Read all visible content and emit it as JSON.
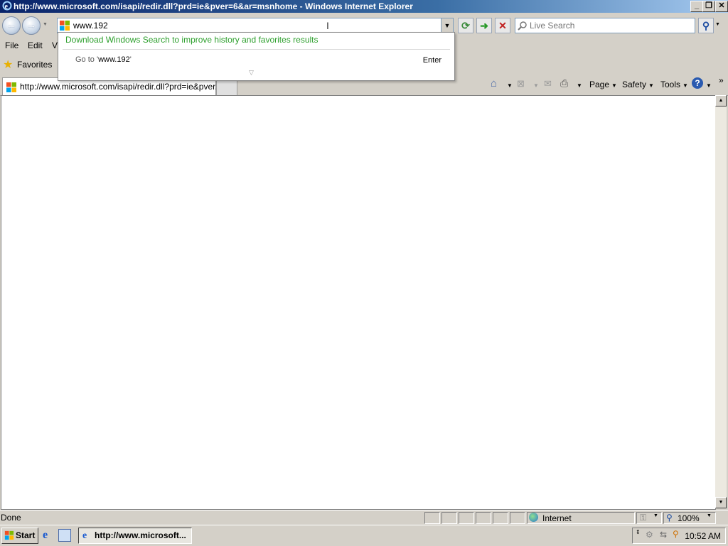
{
  "window": {
    "title": "http://www.microsoft.com/isapi/redir.dll?prd=ie&pver=6&ar=msnhome - Windows Internet Explorer",
    "minimize_label": "_",
    "maximize_label": "❐",
    "close_label": "✕"
  },
  "nav": {
    "address_value": "www.192",
    "search_placeholder": "Live Search"
  },
  "menu": {
    "items": [
      "File",
      "Edit",
      "V"
    ]
  },
  "favorites": {
    "label": "Favorites"
  },
  "tabs": [
    {
      "label": "http://www.microsoft.com/isapi/redir.dll?prd=ie&pver..."
    }
  ],
  "commandbar": {
    "page_label": "Page",
    "safety_label": "Safety",
    "tools_label": "Tools"
  },
  "autocomplete": {
    "promo_text": "Download Windows Search to improve history and favorites results",
    "goto_prefix": "Go to '",
    "goto_value": "www.192",
    "goto_suffix": "'",
    "enter_label": "Enter"
  },
  "statusbar": {
    "status_text": "Done",
    "zone_label": "Internet",
    "zoom_label": "100%"
  },
  "taskbar": {
    "start_label": "Start",
    "task_label": "http://www.microsoft...",
    "clock": "10:52 AM"
  },
  "colors": {
    "title_bar": "#0a246a",
    "promo_green": "#2ea02e",
    "chrome_gray": "#d4d0c8"
  }
}
